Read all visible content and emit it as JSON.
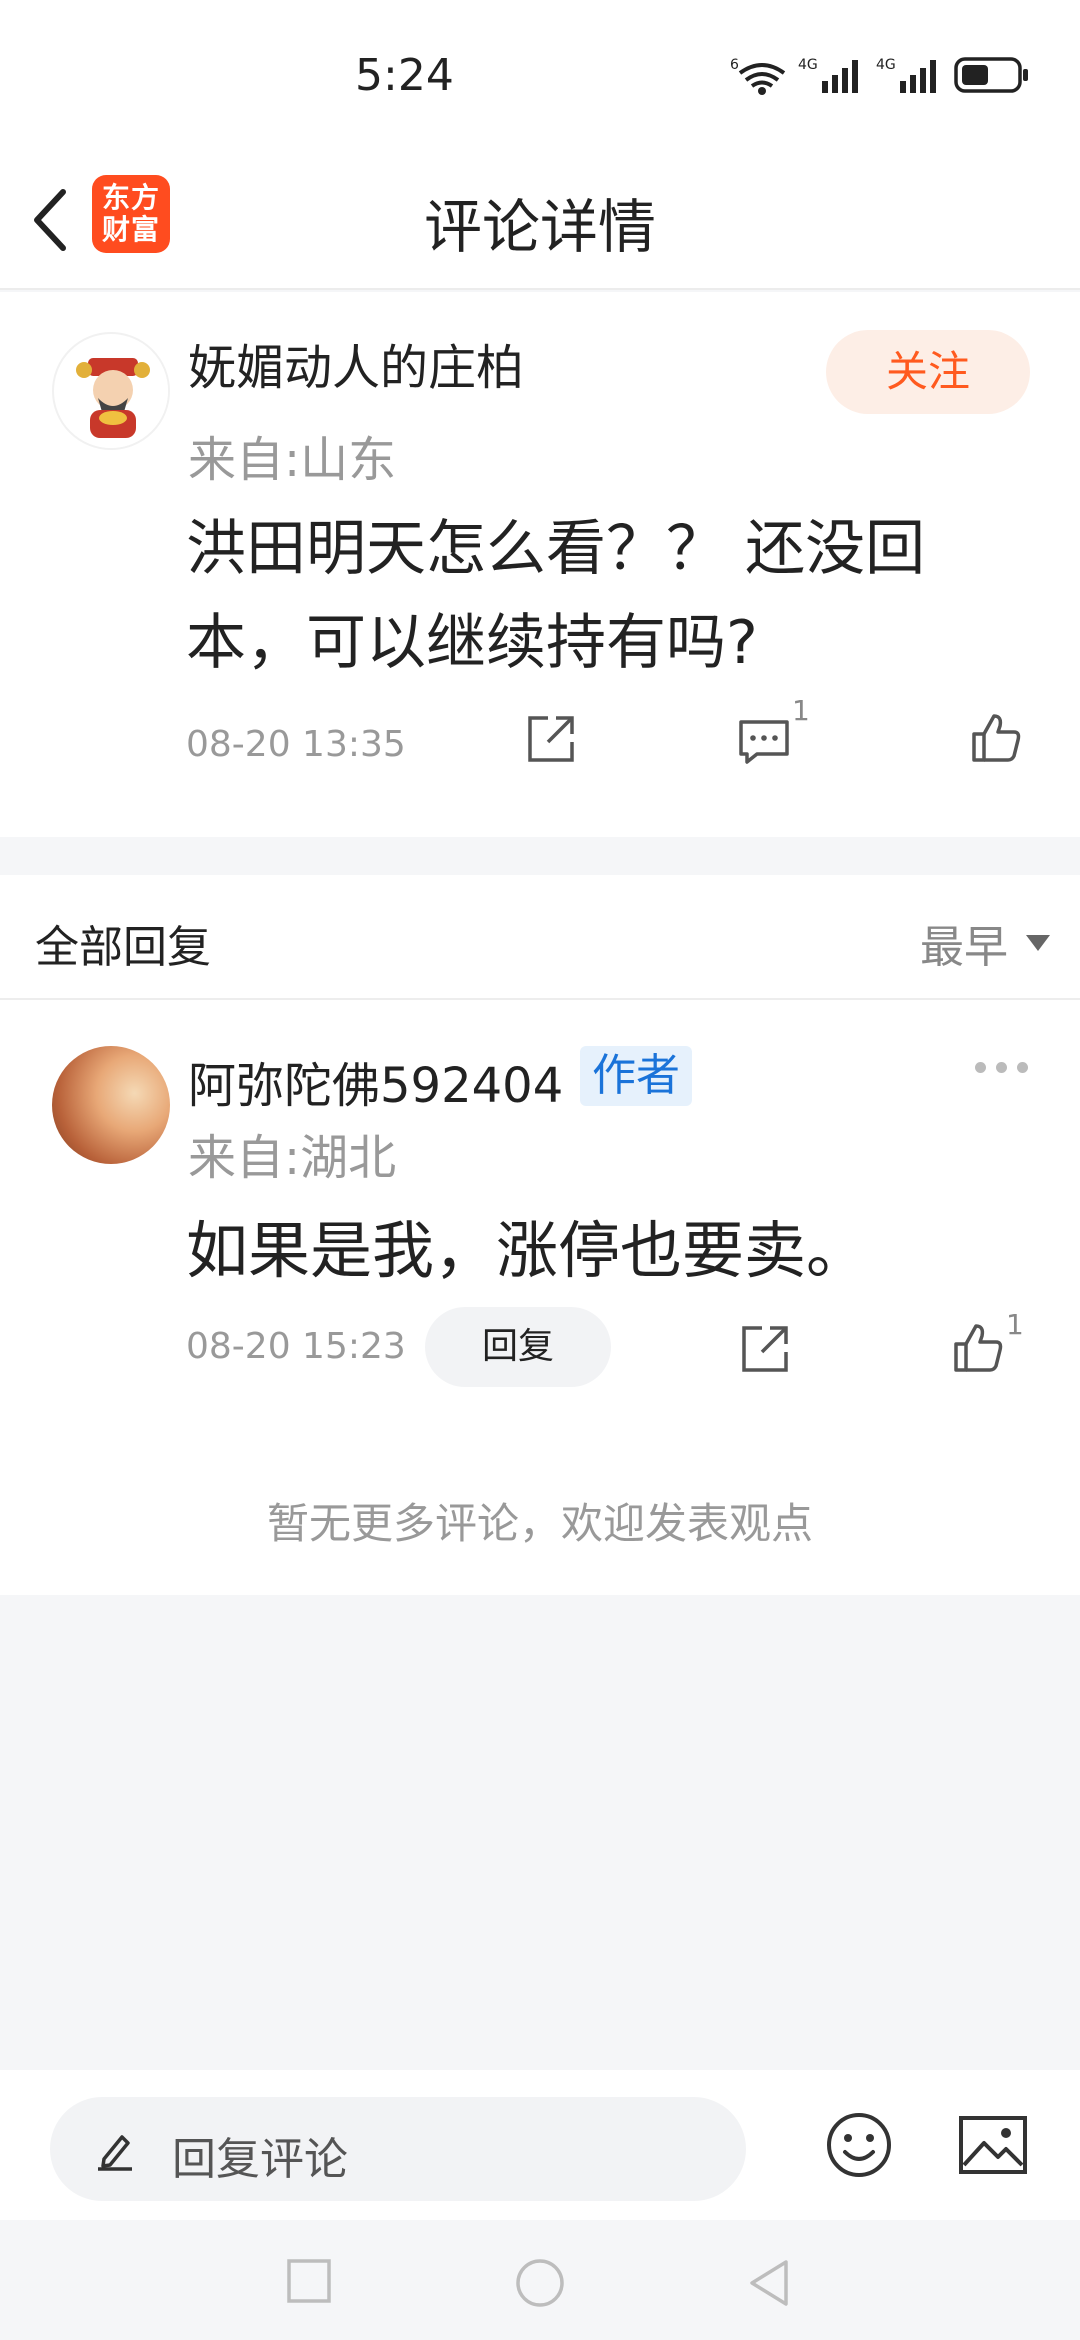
{
  "status_bar": {
    "time": "5:24",
    "network_1": "4G",
    "network_2": "4G",
    "wifi_label": "6"
  },
  "nav": {
    "logo_line1": "东方",
    "logo_line2": "财富",
    "title": "评论详情"
  },
  "main_comment": {
    "username": "妩媚动人的庄柏",
    "location": "来自:山东",
    "follow_label": "关注",
    "text_line1": "洪田明天怎么看？？ 还没回",
    "text_line2": "本，可以继续持有吗?",
    "time": "08-20 13:35",
    "comment_count": "1",
    "accent_color": "#ff5a1f"
  },
  "replies": {
    "title": "全部回复",
    "sort_label": "最早",
    "items": [
      {
        "username": "阿弥陀佛592404",
        "badge": "作者",
        "location": "来自:湖北",
        "text": "如果是我，涨停也要卖。",
        "time": "08-20 15:23",
        "reply_label": "回复",
        "like_count": "1"
      }
    ],
    "no_more_text": "暂无更多评论，欢迎发表观点"
  },
  "input_bar": {
    "placeholder": "回复评论"
  },
  "icons": {
    "back": "chevron-left-icon",
    "share": "share-icon",
    "comment": "comment-icon",
    "like": "thumbs-up-icon",
    "emoji": "emoji-icon",
    "image": "image-icon",
    "pencil": "pencil-icon"
  }
}
